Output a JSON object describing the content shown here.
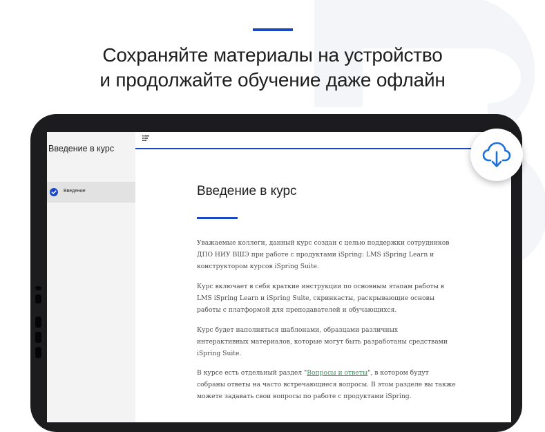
{
  "promo": {
    "headline_line1": "Сохраняйте материалы на устройство",
    "headline_line2": "и продолжайте обучение даже офлайн"
  },
  "colors": {
    "accent": "#1a47c4",
    "link": "#2e9a55",
    "bezel": "#1c1c1e",
    "sidebar_bg": "#f3f3f3",
    "sidebar_active": "#e2e2e2",
    "download_icon": "#1a6fd8"
  },
  "icons": {
    "menu": "menu-list-icon",
    "check": "check-circle-icon",
    "download": "cloud-download-icon"
  },
  "sidebar": {
    "course_title": "Введение в курс",
    "items": [
      {
        "label": "Введение",
        "completed": true
      }
    ]
  },
  "content": {
    "title": "Введение в курс",
    "paragraphs": [
      [
        "Уважаемые коллеги, данный курс создан с целью поддержки сотрудников",
        "ДПО  НИУ ВШЭ при работе с продуктами iSpring: LMS iSpring Learn и",
        "конструктором курсов iSpring Suite."
      ],
      [
        "Курс включает в себя краткие инструкции по основным этапам работы в",
        "LMS iSpring Learn и iSpring Suite, скринкасты, раскрывающие основы",
        "работы с платформой для преподавателей и обучающихся."
      ],
      [
        "Курс будет наполняться шаблонами, образцами различных",
        "интерактивных материалов, которые могут быть разработаны средствами",
        "iSpring Suite."
      ]
    ],
    "para4": {
      "line1_before": "В курсе есть отдельный раздел \"",
      "link_text": "Вопросы и ответы",
      "line1_after": "\", в котором будут",
      "line2": "собраны ответы на часто встречающиеся вопросы. В этом разделе вы также",
      "line3": "можете задавать свои вопросы по работе с продуктами iSpring."
    }
  }
}
